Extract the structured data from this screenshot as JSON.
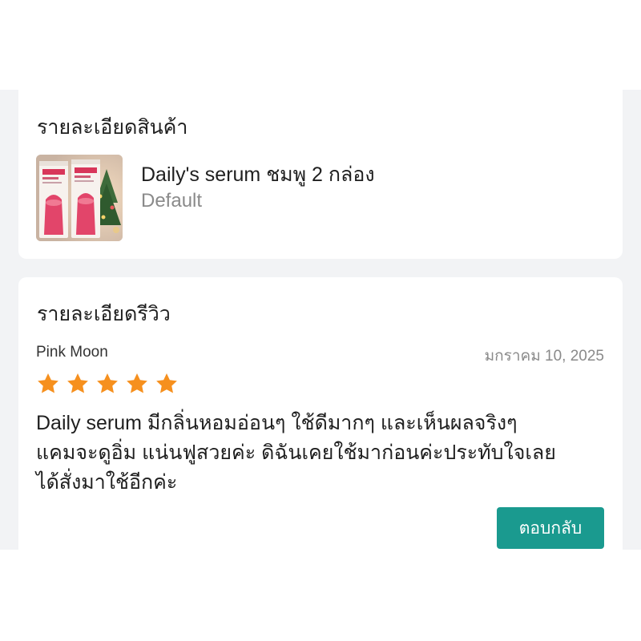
{
  "colors": {
    "page_background": "#f2f3f5",
    "card_background": "#ffffff",
    "star_color": "#f6901e",
    "reply_button_background": "#1a9a8f",
    "muted_text": "#8a8a8a"
  },
  "product_section": {
    "title": "รายละเอียดสินค้า",
    "product_name": "Daily's serum ชมพู 2 กล่อง",
    "variant": "Default",
    "thumbnail_icon": "product-thumbnail"
  },
  "review_section": {
    "title": "รายละเอียดรีวิว",
    "reviewer": "Pink Moon",
    "date": "มกราคม 10, 2025",
    "rating": 5,
    "rating_max": 5,
    "text_lines": [
      "Daily serum มีกลิ่นหอมอ่อนๆ ใช้ดีมากๆ และเห็นผลจริงๆ",
      "แคมจะดูอิ่ม แน่นฟูสวยค่ะ ดิฉันเคยใช้มาก่อนค่ะประทับใจเลย",
      "ได้สั่งมาใช้อีกค่ะ"
    ],
    "reply_button_label": "ตอบกลับ"
  }
}
